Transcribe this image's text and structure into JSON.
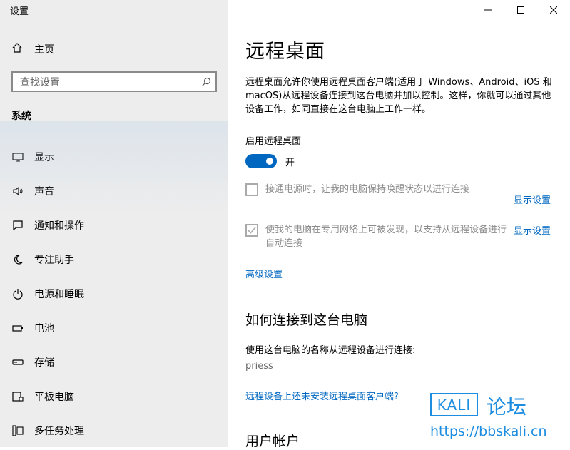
{
  "window": {
    "title": "设置"
  },
  "sidebar": {
    "home_label": "主页",
    "search_placeholder": "查找设置",
    "section_title": "系统",
    "items": [
      {
        "label": "显示",
        "icon": "monitor-icon"
      },
      {
        "label": "声音",
        "icon": "speaker-icon"
      },
      {
        "label": "通知和操作",
        "icon": "notification-icon"
      },
      {
        "label": "专注助手",
        "icon": "moon-icon"
      },
      {
        "label": "电源和睡眠",
        "icon": "power-icon"
      },
      {
        "label": "电池",
        "icon": "battery-icon"
      },
      {
        "label": "存储",
        "icon": "storage-icon"
      },
      {
        "label": "平板电脑",
        "icon": "tablet-icon"
      },
      {
        "label": "多任务处理",
        "icon": "multitask-icon"
      }
    ]
  },
  "main": {
    "title": "远程桌面",
    "description": "远程桌面允许你使用远程桌面客户端(适用于 Windows、Android、iOS 和 macOS)从远程设备连接到这台电脑并加以控制。这样，你就可以通过其他设备工作，如同直接在这台电脑上工作一样。",
    "enable_label": "启用远程桌面",
    "toggle_state": "开",
    "option1": {
      "text": "接通电源时，让我的电脑保持唤醒状态以进行连接",
      "link": "显示设置",
      "checked": false
    },
    "option2": {
      "text": "使我的电脑在专用网络上可被发现，以支持从远程设备进行自动连接",
      "link": "显示设置",
      "checked": true
    },
    "advanced_link": "高级设置",
    "how_to_title": "如何连接到这台电脑",
    "connect_label": "使用这台电脑的名称从远程设备进行连接:",
    "pc_name": "priess",
    "no_client_link": "远程设备上还未安装远程桌面客户端?",
    "user_accounts_title": "用户帐户"
  },
  "watermark": {
    "box": "KALI",
    "text": "论坛",
    "url": "https://bbskali.cn"
  },
  "colors": {
    "accent": "#0067c0",
    "sidebar_bg": "#ededed",
    "watermark": "#1c8de0"
  }
}
